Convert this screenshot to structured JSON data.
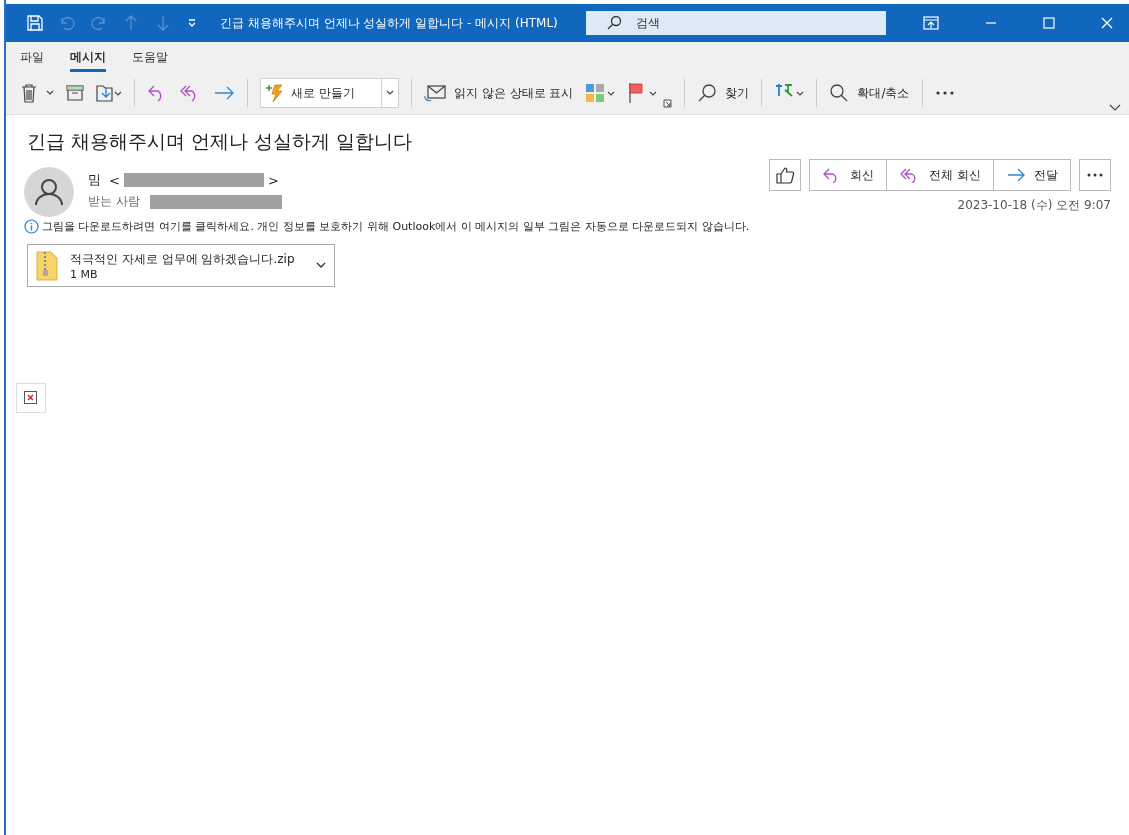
{
  "window": {
    "title": "긴급 채용해주시며 언제나 성실하게 일합니다  -  메시지 (HTML)",
    "search_placeholder": "검색"
  },
  "tabs": [
    {
      "label": "파일",
      "selected": false
    },
    {
      "label": "메시지",
      "selected": true
    },
    {
      "label": "도움말",
      "selected": false
    }
  ],
  "toolbar": {
    "new_item": "새로 만들기",
    "mark_unread": "읽지 않은 상태로 표시",
    "find": "찾기",
    "zoom": "확대/축소"
  },
  "message": {
    "subject": "긴급 채용해주시며 언제나 성실하게 일합니다",
    "sender_name": "밈",
    "sender_open": "<",
    "sender_close": ">",
    "to_label": "받는 사람",
    "date": "2023-10-18 (수) 오전 9:07",
    "info": "그림을 다운로드하려면 여기를 클릭하세요. 개인 정보를 보호하기 위해 Outlook에서 이 메시지의 일부 그림은 자동으로 다운로드되지 않습니다.",
    "actions": {
      "reply": "회신",
      "reply_all": "전체 회신",
      "forward": "전달"
    },
    "attachment": {
      "name": "적극적인 자세로 업무에 임하겠습니다.zip",
      "size": "1 MB"
    }
  }
}
